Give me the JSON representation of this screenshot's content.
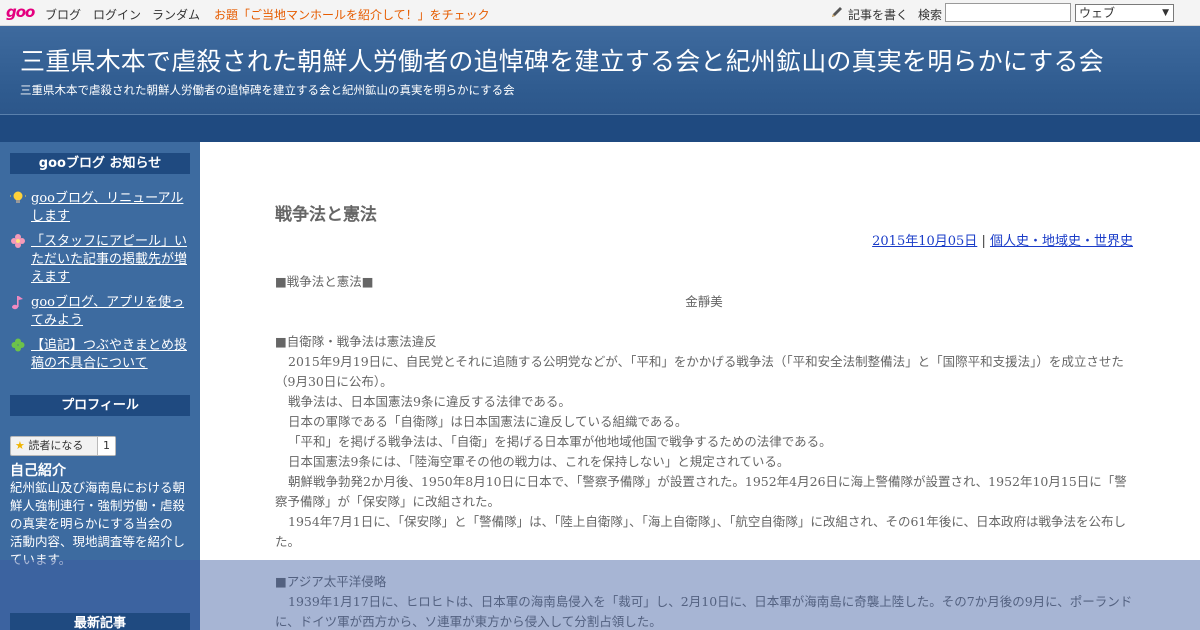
{
  "toolbar": {
    "logo": "goo",
    "links": [
      "ブログ",
      "ログイン",
      "ランダム"
    ],
    "promo": "お題「ご当地マンホールを紹介して！」をチェック",
    "write_label": "記事を書く",
    "search_label": "検索",
    "search_value": "",
    "select_value": "ウェブ"
  },
  "header": {
    "title": "三重県木本で虐殺された朝鮮人労働者の追悼碑を建立する会と紀州鉱山の真実を明らかにする会",
    "description": "三重県木本で虐殺された朝鮮人労働者の追悼碑を建立する会と紀州鉱山の真実を明らかにする会"
  },
  "sidebar": {
    "notice_title": "gooブログ お知らせ",
    "notices": [
      {
        "icon": "lightbulb-icon",
        "label": "gooブログ、リニューアルします"
      },
      {
        "icon": "flower-icon",
        "label": "「スタッフにアピール」いただいた記事の掲載先が増えます"
      },
      {
        "icon": "music-note-icon",
        "label": "gooブログ、アプリを使ってみよう"
      },
      {
        "icon": "clover-icon",
        "label": "【追記】つぶやきまとめ投稿の不具合について"
      }
    ],
    "profile_title": "プロフィール",
    "follow_label": "読者になる",
    "follow_count": "1",
    "intro_heading": "自己紹介",
    "intro_text": "紀州鉱山及び海南島における朝鮮人強制連行・強制労働・虐殺の真実を明らかにする当会の活動内容、現地調査等を紹介しています。",
    "latest_title": "最新記事"
  },
  "article": {
    "title": "戦争法と憲法",
    "date": "2015年10月05日",
    "separator": "|",
    "category": "個人史・地域史・世界史",
    "heading1": "■戦争法と憲法■",
    "author": "金靜美",
    "heading2": "■自衛隊・戦争法は憲法違反",
    "paras": [
      "2015年9月19日に、自民党とそれに追随する公明党などが、「平和」をかかげる戦争法（「平和安全法制整備法」と「国際平和支援法」）を成立させた（9月30日に公布）。",
      "戦争法は、日本国憲法9条に違反する法律である。",
      "日本の軍隊である「自衛隊」は日本国憲法に違反している組織である。",
      "「平和」を掲げる戦争法は、「自衛」を掲げる日本軍が他地域他国で戦争するための法律である。",
      "日本国憲法9条には、「陸海空軍その他の戦力は、これを保持しない」と規定されている。",
      "朝鮮戦争勃発2か月後、1950年8月10日に日本で、「警察予備隊」が設置された。1952年4月26日に海上警備隊が設置され、1952年10月15日に「警察予備隊」が「保安隊」に改組された。",
      "1954年7月1日に、「保安隊」と「警備隊」は、「陸上自衛隊」、「海上自衛隊」、「航空自衛隊」に改組され、その61年後に、日本政府は戦争法を公布した。"
    ],
    "heading3": "■アジア太平洋侵略",
    "paras2": [
      "1939年1月17日に、ヒロヒトは、日本軍の海南島侵入を「裁可」し、2月10日に、日本軍が海南島に奇襲上陸した。その7か月後の9月に、ポーランドに、ドイツ軍が西方から、ソ連軍が東方から侵入して分割占領した。"
    ]
  }
}
